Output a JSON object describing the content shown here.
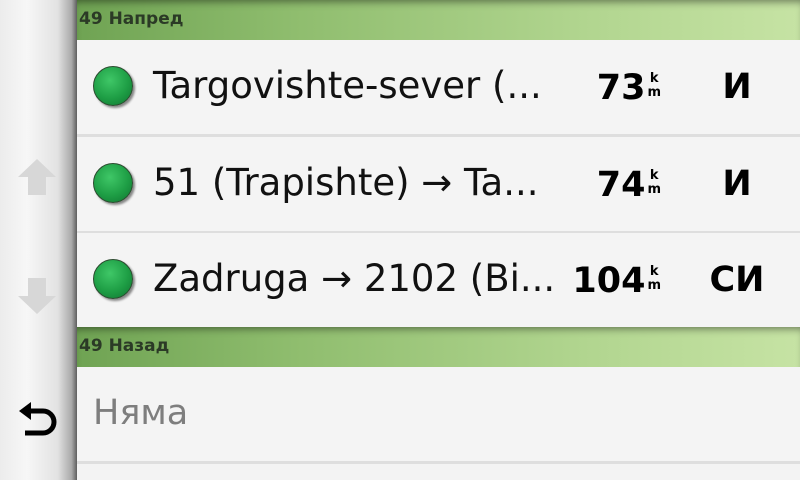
{
  "sections": {
    "forward": {
      "title": "49 Напред",
      "rows": [
        {
          "name": "Targovishte-sever (...",
          "distance": "73",
          "unit_top": "k",
          "unit_bottom": "m",
          "direction": "И"
        },
        {
          "name": "51 (Trapishte) → Ta...",
          "distance": "74",
          "unit_top": "k",
          "unit_bottom": "m",
          "direction": "И"
        },
        {
          "name": "Zadruga → 2102 (Bi...",
          "distance": "104",
          "unit_top": "k",
          "unit_bottom": "m",
          "direction": "СИ"
        }
      ]
    },
    "backward": {
      "title": "49 Назад",
      "empty_text": "Няма"
    }
  },
  "icons": {
    "status": "green-circle-icon",
    "scroll_up": "arrow-up-icon",
    "scroll_down": "arrow-down-icon",
    "back": "back-arrow-icon"
  },
  "colors": {
    "header_green": "#8fbd6e",
    "status_green": "#1e9e45"
  }
}
